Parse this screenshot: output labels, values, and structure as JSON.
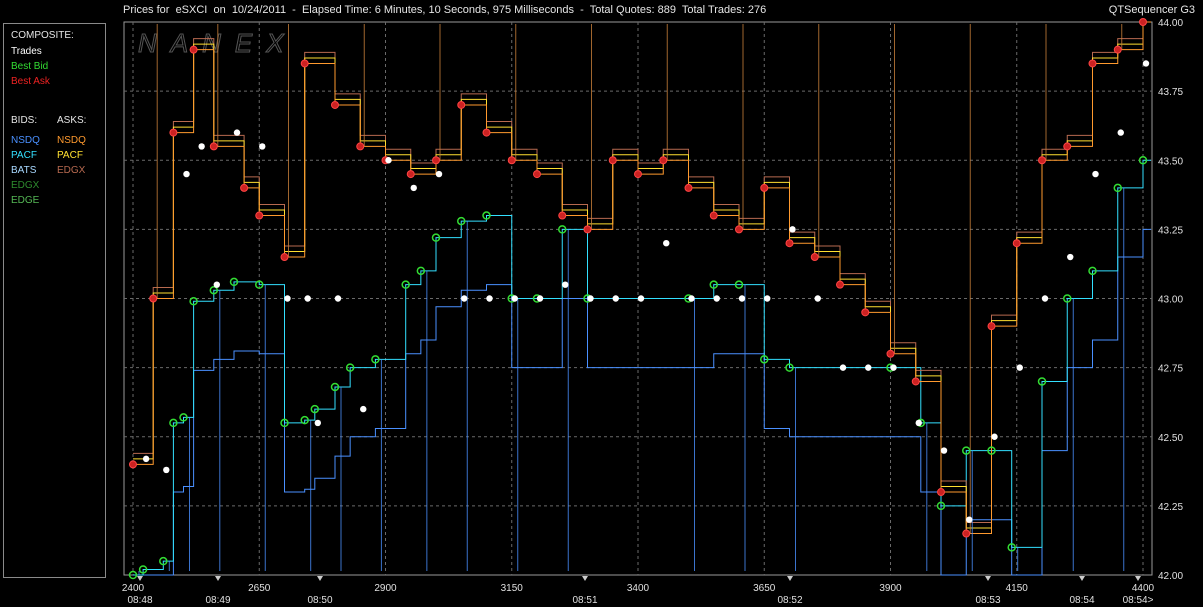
{
  "header": {
    "title": "Prices for  eSXCI  on  10/24/2011  -  Elapsed Time: 6 Minutes, 10 Seconds, 975 Milliseconds  -  Total Quotes: 889  Total Trades: 276",
    "app_name": "QTSequencer G3",
    "watermark": "NANEX"
  },
  "legend": {
    "composite_header": "COMPOSITE:",
    "composite_items": [
      {
        "label": "Trades",
        "color": "#ffffff"
      },
      {
        "label": "Best Bid",
        "color": "#33dd33"
      },
      {
        "label": "Best Ask",
        "color": "#ee2222"
      }
    ],
    "bids_header": "BIDS:",
    "asks_header": "ASKS:",
    "bids": [
      {
        "label": "NSDQ",
        "color": "#4a90ff"
      },
      {
        "label": "PACF",
        "color": "#33e0ff"
      },
      {
        "label": "BATS",
        "color": "#a8d8ff"
      },
      {
        "label": "EDGX",
        "color": "#2e8b2e"
      },
      {
        "label": "EDGE",
        "color": "#55b855"
      }
    ],
    "asks": [
      {
        "label": "NSDQ",
        "color": "#ff9a2e"
      },
      {
        "label": "PACF",
        "color": "#ffe030"
      },
      {
        "label": "EDGX",
        "color": "#b86a50"
      }
    ]
  },
  "chart_data": {
    "type": "line",
    "title": "Prices for  eSXCI  on  10/24/2011",
    "ylim": [
      42.0,
      44.0
    ],
    "y_ticks": [
      "44.00",
      "43.75",
      "43.50",
      "43.25",
      "43.00",
      "42.75",
      "42.50",
      "42.25",
      "42.00"
    ],
    "x_ticks": [
      "2400",
      "2650",
      "2900",
      "3150",
      "3400",
      "3650",
      "3900",
      "4150",
      "4400"
    ],
    "time_labels": [
      "08:48",
      "08:49",
      "08:50",
      "08:51",
      "08:52",
      "08:53",
      "08:54",
      "08:54>"
    ],
    "best_bid_steps": [
      [
        2400,
        42.0
      ],
      [
        2420,
        42.02
      ],
      [
        2460,
        42.05
      ],
      [
        2480,
        42.55
      ],
      [
        2500,
        42.57
      ],
      [
        2520,
        42.99
      ],
      [
        2560,
        43.03
      ],
      [
        2600,
        43.06
      ],
      [
        2650,
        43.05
      ],
      [
        2700,
        42.55
      ],
      [
        2740,
        42.56
      ],
      [
        2760,
        42.6
      ],
      [
        2800,
        42.68
      ],
      [
        2830,
        42.75
      ],
      [
        2880,
        42.78
      ],
      [
        2940,
        43.05
      ],
      [
        2970,
        43.1
      ],
      [
        3000,
        43.22
      ],
      [
        3050,
        43.28
      ],
      [
        3100,
        43.3
      ],
      [
        3150,
        43.0
      ],
      [
        3200,
        43.0
      ],
      [
        3250,
        43.25
      ],
      [
        3300,
        43.0
      ],
      [
        3500,
        43.0
      ],
      [
        3550,
        43.05
      ],
      [
        3600,
        43.05
      ],
      [
        3650,
        42.78
      ],
      [
        3700,
        42.75
      ],
      [
        3900,
        42.75
      ],
      [
        3960,
        42.55
      ],
      [
        4000,
        42.25
      ],
      [
        4050,
        42.45
      ],
      [
        4100,
        42.45
      ],
      [
        4140,
        42.1
      ],
      [
        4200,
        42.7
      ],
      [
        4250,
        43.0
      ],
      [
        4300,
        43.1
      ],
      [
        4350,
        43.4
      ],
      [
        4400,
        43.5
      ]
    ],
    "best_ask_steps": [
      [
        2400,
        42.4
      ],
      [
        2440,
        43.0
      ],
      [
        2480,
        43.6
      ],
      [
        2520,
        43.9
      ],
      [
        2560,
        43.55
      ],
      [
        2620,
        43.4
      ],
      [
        2650,
        43.3
      ],
      [
        2700,
        43.15
      ],
      [
        2740,
        43.85
      ],
      [
        2800,
        43.7
      ],
      [
        2850,
        43.55
      ],
      [
        2900,
        43.5
      ],
      [
        2950,
        43.45
      ],
      [
        3000,
        43.5
      ],
      [
        3050,
        43.7
      ],
      [
        3100,
        43.6
      ],
      [
        3150,
        43.5
      ],
      [
        3200,
        43.45
      ],
      [
        3250,
        43.3
      ],
      [
        3300,
        43.25
      ],
      [
        3350,
        43.5
      ],
      [
        3400,
        43.45
      ],
      [
        3450,
        43.5
      ],
      [
        3500,
        43.4
      ],
      [
        3550,
        43.3
      ],
      [
        3600,
        43.25
      ],
      [
        3650,
        43.4
      ],
      [
        3700,
        43.2
      ],
      [
        3750,
        43.15
      ],
      [
        3800,
        43.05
      ],
      [
        3850,
        42.95
      ],
      [
        3900,
        42.8
      ],
      [
        3950,
        42.7
      ],
      [
        4000,
        42.3
      ],
      [
        4050,
        42.15
      ],
      [
        4100,
        42.9
      ],
      [
        4150,
        43.2
      ],
      [
        4200,
        43.5
      ],
      [
        4250,
        43.55
      ],
      [
        4300,
        43.85
      ],
      [
        4350,
        43.9
      ],
      [
        4400,
        44.0
      ]
    ],
    "trades": [
      [
        2420,
        42.42
      ],
      [
        2460,
        42.38
      ],
      [
        2500,
        43.45
      ],
      [
        2530,
        43.55
      ],
      [
        2560,
        43.05
      ],
      [
        2600,
        43.6
      ],
      [
        2650,
        43.55
      ],
      [
        2700,
        43.0
      ],
      [
        2740,
        43.0
      ],
      [
        2760,
        42.55
      ],
      [
        2800,
        43.0
      ],
      [
        2850,
        42.6
      ],
      [
        2900,
        43.5
      ],
      [
        2950,
        43.4
      ],
      [
        3000,
        43.45
      ],
      [
        3050,
        43.0
      ],
      [
        3100,
        43.0
      ],
      [
        3150,
        43.0
      ],
      [
        3200,
        43.0
      ],
      [
        3250,
        43.05
      ],
      [
        3300,
        43.0
      ],
      [
        3350,
        43.0
      ],
      [
        3400,
        43.0
      ],
      [
        3450,
        43.2
      ],
      [
        3500,
        43.0
      ],
      [
        3550,
        43.0
      ],
      [
        3600,
        43.0
      ],
      [
        3650,
        43.0
      ],
      [
        3700,
        43.25
      ],
      [
        3750,
        43.0
      ],
      [
        3800,
        42.75
      ],
      [
        3850,
        42.75
      ],
      [
        3900,
        42.75
      ],
      [
        3950,
        42.55
      ],
      [
        4000,
        42.45
      ],
      [
        4050,
        42.2
      ],
      [
        4100,
        42.5
      ],
      [
        4150,
        42.75
      ],
      [
        4200,
        43.0
      ],
      [
        4250,
        43.15
      ],
      [
        4300,
        43.45
      ],
      [
        4350,
        43.6
      ],
      [
        4400,
        43.85
      ]
    ]
  }
}
